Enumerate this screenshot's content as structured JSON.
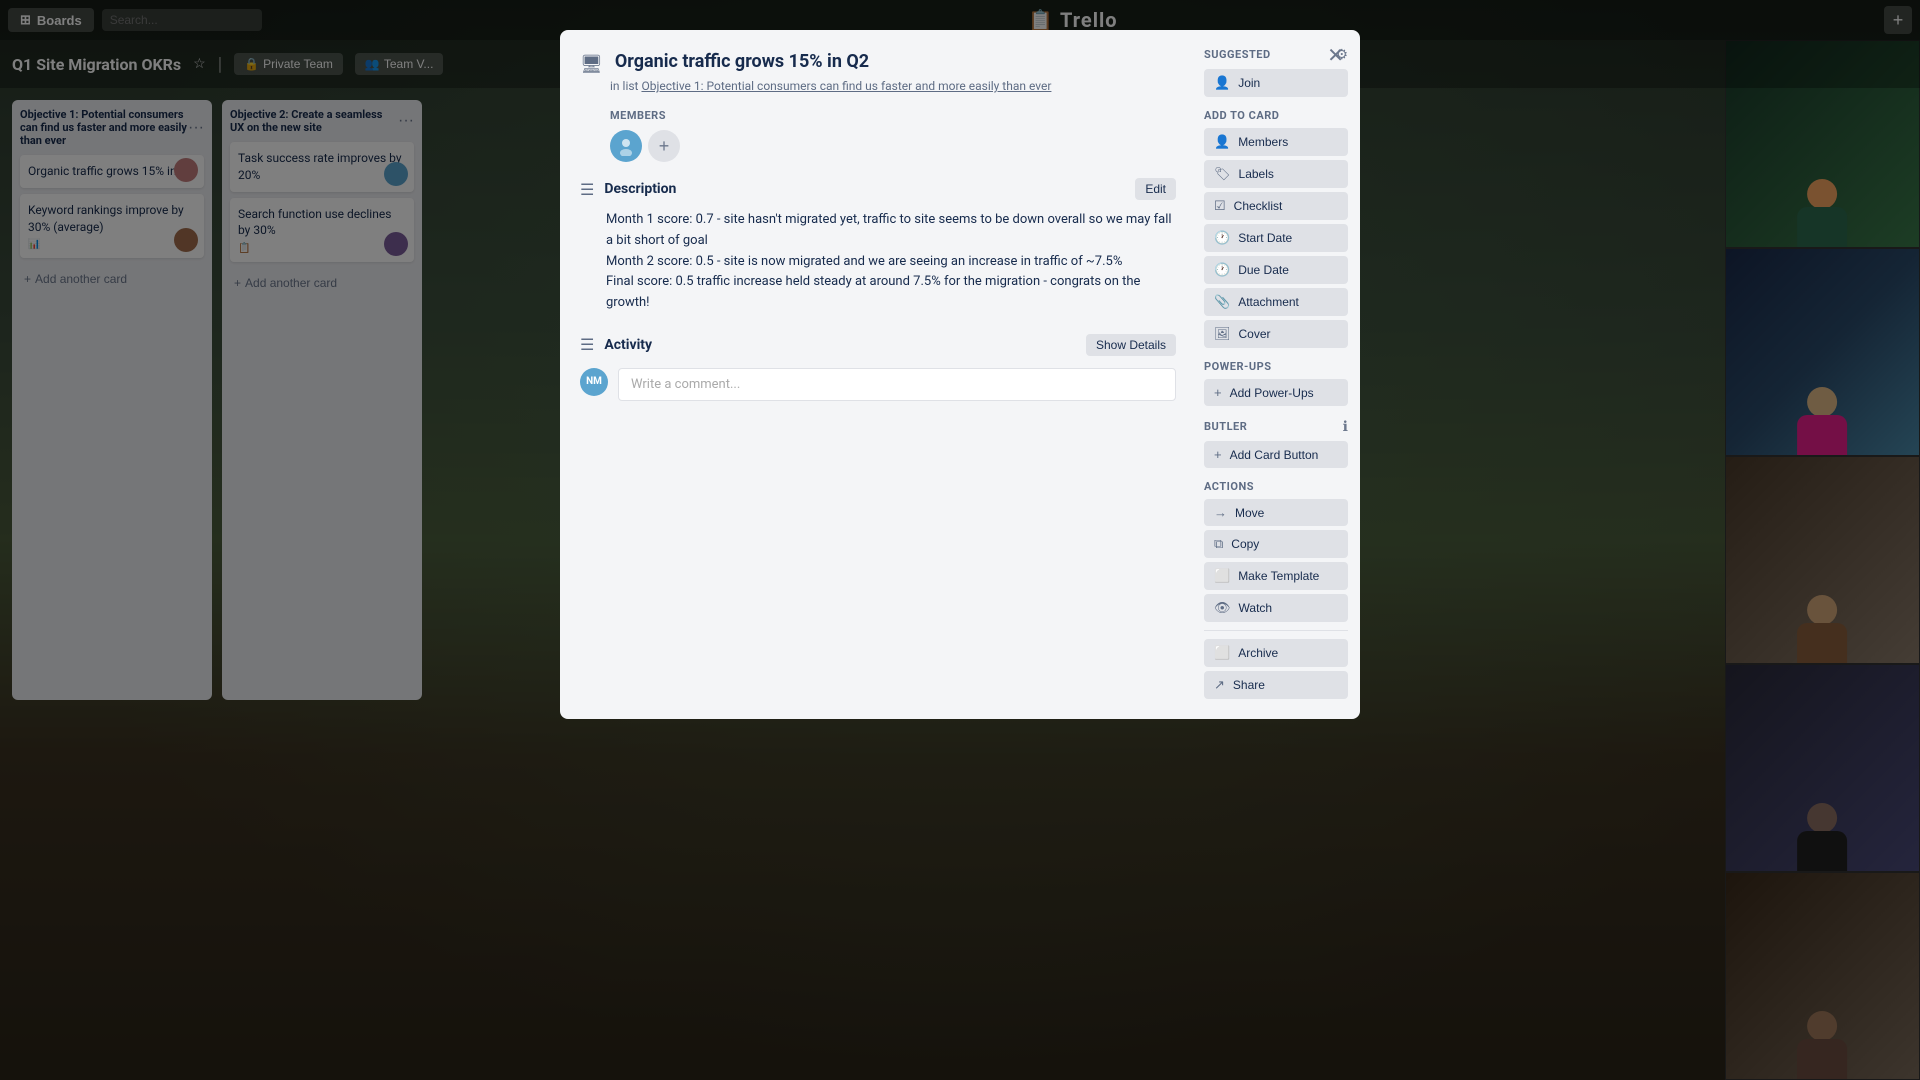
{
  "app": {
    "name": "Trello"
  },
  "topbar": {
    "boards_label": "Boards",
    "search_placeholder": "Search...",
    "plus_label": "+"
  },
  "board": {
    "title": "Q1 Site Migration OKRs",
    "visibility": "Private Team",
    "team_label": "Team V..."
  },
  "lists": [
    {
      "id": "list-1",
      "title": "Objective 1: Potential consumers can find us faster and more easily than ever",
      "cards": [
        {
          "id": "c1",
          "title": "Organic traffic grows 15% in Q2",
          "avatar_color": "#c27c7c",
          "avatar_initials": ""
        },
        {
          "id": "c2",
          "title": "Keyword rankings improve by 30% (average)",
          "avatar_color": "#a26c4c",
          "avatar_initials": "",
          "has_icon": true
        }
      ]
    },
    {
      "id": "list-2",
      "title": "Objective 2: Create a seamless UX on the new site",
      "cards": [
        {
          "id": "c3",
          "title": "Task success rate improves by 20%",
          "avatar_color": "#5ba4cf",
          "avatar_initials": "",
          "has_icon": false
        },
        {
          "id": "c4",
          "title": "Search function use declines by 30%",
          "avatar_color": "#7a5c9a",
          "avatar_initials": "",
          "has_icon": true
        }
      ]
    }
  ],
  "modal": {
    "title": "Organic traffic grows 15% in Q2",
    "list_ref_prefix": "in list",
    "list_ref_text": "Objective 1: Potential consumers can find us faster and more easily than ever",
    "members_label": "MEMBERS",
    "member_avatar_color": "#5ba4cf",
    "member_initials": "",
    "description_label": "Description",
    "edit_btn_label": "Edit",
    "description_lines": [
      "Month 1 score: 0.7 - site hasn't migrated yet, traffic to site seems to be down",
      "overall so we may fall a bit short of goal",
      "Month 2 score: 0.5 - site is now migrated and we are seeing an increase in",
      "traffic of ~7.5%",
      "Final score: 0.5 traffic increase held steady at around 7.5% for the migration -",
      "congrats on the growth!"
    ],
    "activity_label": "Activity",
    "show_details_label": "Show Details",
    "comment_placeholder": "Write a comment...",
    "comment_avatar_initials": "NM",
    "comment_avatar_color": "#5ba4cf"
  },
  "sidebar": {
    "suggested_label": "SUGGESTED",
    "join_label": "Join",
    "add_to_card_label": "ADD TO CARD",
    "members_label": "Members",
    "labels_label": "Labels",
    "checklist_label": "Checklist",
    "start_date_label": "Start Date",
    "due_date_label": "Due Date",
    "attachment_label": "Attachment",
    "cover_label": "Cover",
    "power_ups_label": "POWER-UPS",
    "add_power_ups_label": "Add Power-Ups",
    "butler_label": "BUTLER",
    "add_card_button_label": "Add Card Button",
    "actions_label": "ACTIONS",
    "move_label": "Move",
    "copy_label": "Copy",
    "make_template_label": "Make Template",
    "watch_label": "Watch",
    "archive_label": "Archive",
    "share_label": "Share"
  },
  "video_tiles": [
    {
      "id": "vt1",
      "head_color": "#f4a460",
      "body_color": "#2d6a4f",
      "bg": "tile1"
    },
    {
      "id": "vt2",
      "head_color": "#deb887",
      "body_color": "#e91e8c",
      "bg": "tile2"
    },
    {
      "id": "vt3",
      "head_color": "#d2a679",
      "body_color": "#8b5e3c",
      "bg": "tile3"
    },
    {
      "id": "vt4",
      "head_color": "#8d6e63",
      "body_color": "#212121",
      "bg": "tile4"
    },
    {
      "id": "vt5",
      "head_color": "#a0785a",
      "body_color": "#6d4c41",
      "bg": "tile5"
    }
  ]
}
